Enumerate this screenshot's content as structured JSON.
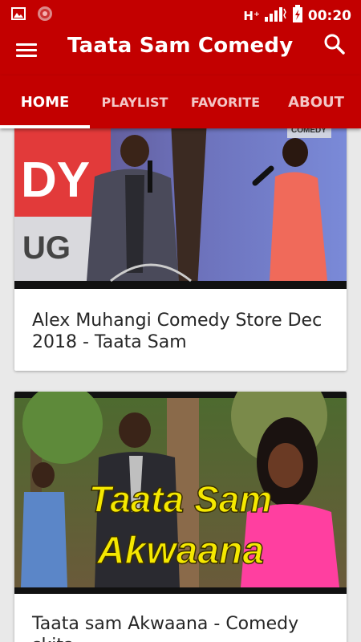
{
  "status_bar": {
    "network": "H⁺",
    "time": "00:20"
  },
  "app_bar": {
    "title": "Taata Sam Comedy"
  },
  "tabs": [
    {
      "label": "HOME",
      "active": true
    },
    {
      "label": "PLAYLIST",
      "active": false
    },
    {
      "label": "FAVORITE",
      "active": false
    },
    {
      "label": "ABOUT",
      "active": false
    }
  ],
  "videos": [
    {
      "title": "Alex Muhangi Comedy Store Dec 2018 - Taata Sam",
      "thumbnail_text": [
        "DY",
        "UG",
        "COMEDY"
      ]
    },
    {
      "title": "Taata sam Akwaana - Comedy skits.",
      "thumbnail_text": [
        "Taata Sam",
        "Akwaana"
      ]
    }
  ],
  "colors": {
    "primary": "#c30000",
    "tab_inactive": "#f3c6c6",
    "thumbnail_title": "#f5e800"
  }
}
